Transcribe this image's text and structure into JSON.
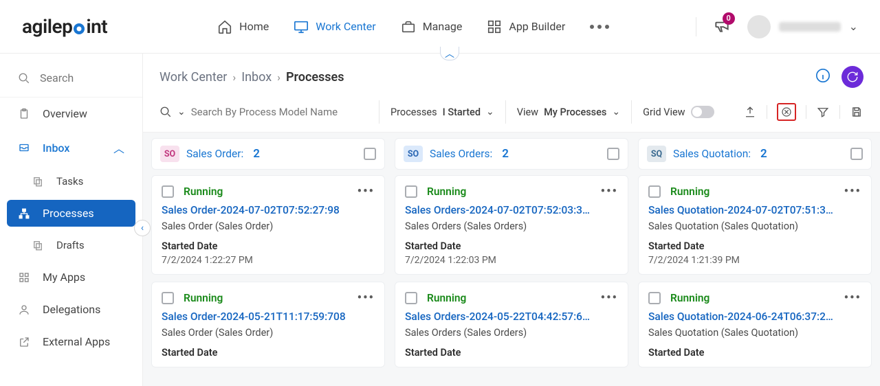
{
  "nav": {
    "home": "Home",
    "work_center": "Work Center",
    "manage": "Manage",
    "app_builder": "App Builder",
    "notif_count": "0"
  },
  "sidebar": {
    "search": "Search",
    "overview": "Overview",
    "inbox": "Inbox",
    "tasks": "Tasks",
    "processes": "Processes",
    "drafts": "Drafts",
    "my_apps": "My Apps",
    "delegations": "Delegations",
    "external_apps": "External Apps"
  },
  "breadcrumb": {
    "a": "Work Center",
    "b": "Inbox",
    "c": "Processes"
  },
  "toolbar": {
    "search_placeholder": "Search By Process Model Name",
    "processes_label": "Processes",
    "processes_value": "I Started",
    "view_label": "View",
    "view_value": "My Processes",
    "grid_label": "Grid View"
  },
  "columns": [
    {
      "badge": "SO",
      "badge_class": "badge-so",
      "title": "Sales Order:",
      "count": "2",
      "cards": [
        {
          "status": "Running",
          "title": "Sales Order-2024-07-02T07:52:27:98",
          "sub": "Sales Order (Sales Order)",
          "label": "Started Date",
          "val": "7/2/2024 1:22:27 PM"
        },
        {
          "status": "Running",
          "title": "Sales Order-2024-05-21T11:17:59:708",
          "sub": "Sales Order (Sales Order)",
          "label": "Started Date",
          "val": ""
        }
      ]
    },
    {
      "badge": "SO",
      "badge_class": "badge-so2",
      "title": "Sales Orders:",
      "count": "2",
      "cards": [
        {
          "status": "Running",
          "title": "Sales Orders-2024-07-02T07:52:03:3…",
          "sub": "Sales Orders (Sales Orders)",
          "label": "Started Date",
          "val": "7/2/2024 1:22:03 PM"
        },
        {
          "status": "Running",
          "title": "Sales Orders-2024-05-22T04:42:57:6…",
          "sub": "Sales Orders (Sales Orders)",
          "label": "Started Date",
          "val": ""
        }
      ]
    },
    {
      "badge": "SQ",
      "badge_class": "badge-sq",
      "title": "Sales Quotation:",
      "count": "2",
      "cards": [
        {
          "status": "Running",
          "title": "Sales Quotation-2024-07-02T07:51:3…",
          "sub": "Sales Quotation (Sales Quotation)",
          "label": "Started Date",
          "val": "7/2/2024 1:21:39 PM"
        },
        {
          "status": "Running",
          "title": "Sales Quotation-2024-06-24T06:37:2…",
          "sub": "Sales Quotation (Sales Quotation)",
          "label": "Started Date",
          "val": ""
        }
      ]
    }
  ]
}
